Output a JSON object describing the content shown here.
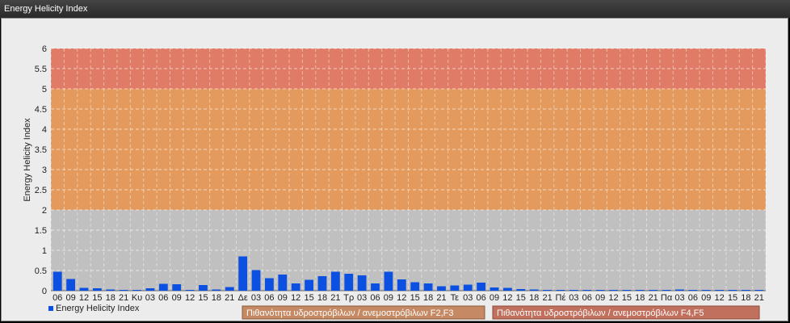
{
  "window": {
    "title": "Energy Helicity Index"
  },
  "chart_data": {
    "type": "bar",
    "title": "",
    "ylabel": "Energy Helicity Index",
    "xlabel": "",
    "ylim": [
      0,
      6
    ],
    "yticks": [
      0,
      0.5,
      1,
      1.5,
      2,
      2.5,
      3,
      3.5,
      4,
      4.5,
      5,
      5.5,
      6
    ],
    "grid": true,
    "bar_color": "#0b50e0",
    "categories": [
      "06",
      "09",
      "12",
      "15",
      "18",
      "21",
      "Κυ",
      "03",
      "06",
      "09",
      "12",
      "15",
      "18",
      "21",
      "Δε",
      "03",
      "06",
      "09",
      "12",
      "15",
      "18",
      "21",
      "Τρ",
      "03",
      "06",
      "09",
      "12",
      "15",
      "18",
      "21",
      "Τε",
      "03",
      "06",
      "09",
      "12",
      "15",
      "18",
      "21",
      "Πέ",
      "03",
      "06",
      "09",
      "12",
      "15",
      "18",
      "21",
      "Πα",
      "03",
      "06",
      "09",
      "12",
      "15",
      "18",
      "21"
    ],
    "series": [
      {
        "name": "Energy Helicity Index",
        "values": [
          0.47,
          0.29,
          0.07,
          0.06,
          0.03,
          0.02,
          0.01,
          0.06,
          0.17,
          0.16,
          0.02,
          0.14,
          0.03,
          0.09,
          0.85,
          0.51,
          0.31,
          0.4,
          0.18,
          0.27,
          0.36,
          0.47,
          0.42,
          0.38,
          0.18,
          0.47,
          0.28,
          0.21,
          0.18,
          0.11,
          0.13,
          0.15,
          0.2,
          0.08,
          0.07,
          0.04,
          0.03,
          0.02,
          0.01,
          0.01,
          0.01,
          0.01,
          0.01,
          0.01,
          0.01,
          0.02,
          0.02,
          0.03,
          0.02,
          0.01,
          0.01,
          0.01,
          0.02,
          0.02
        ]
      }
    ],
    "bands": [
      {
        "from": 2,
        "to": 5,
        "color": "#e39a5c",
        "label": "Πιθανότητα υδροστρόβιλων / ανεμοστρόβιλων F2,F3"
      },
      {
        "from": 5,
        "to": 6,
        "color": "#e07b67",
        "label": "Πιθανότητα υδροστρόβιλων / ανεμοστρόβιλων F4,F5"
      }
    ],
    "below_band_color": "#c0c0c0",
    "legend_position": "bottom-left"
  }
}
